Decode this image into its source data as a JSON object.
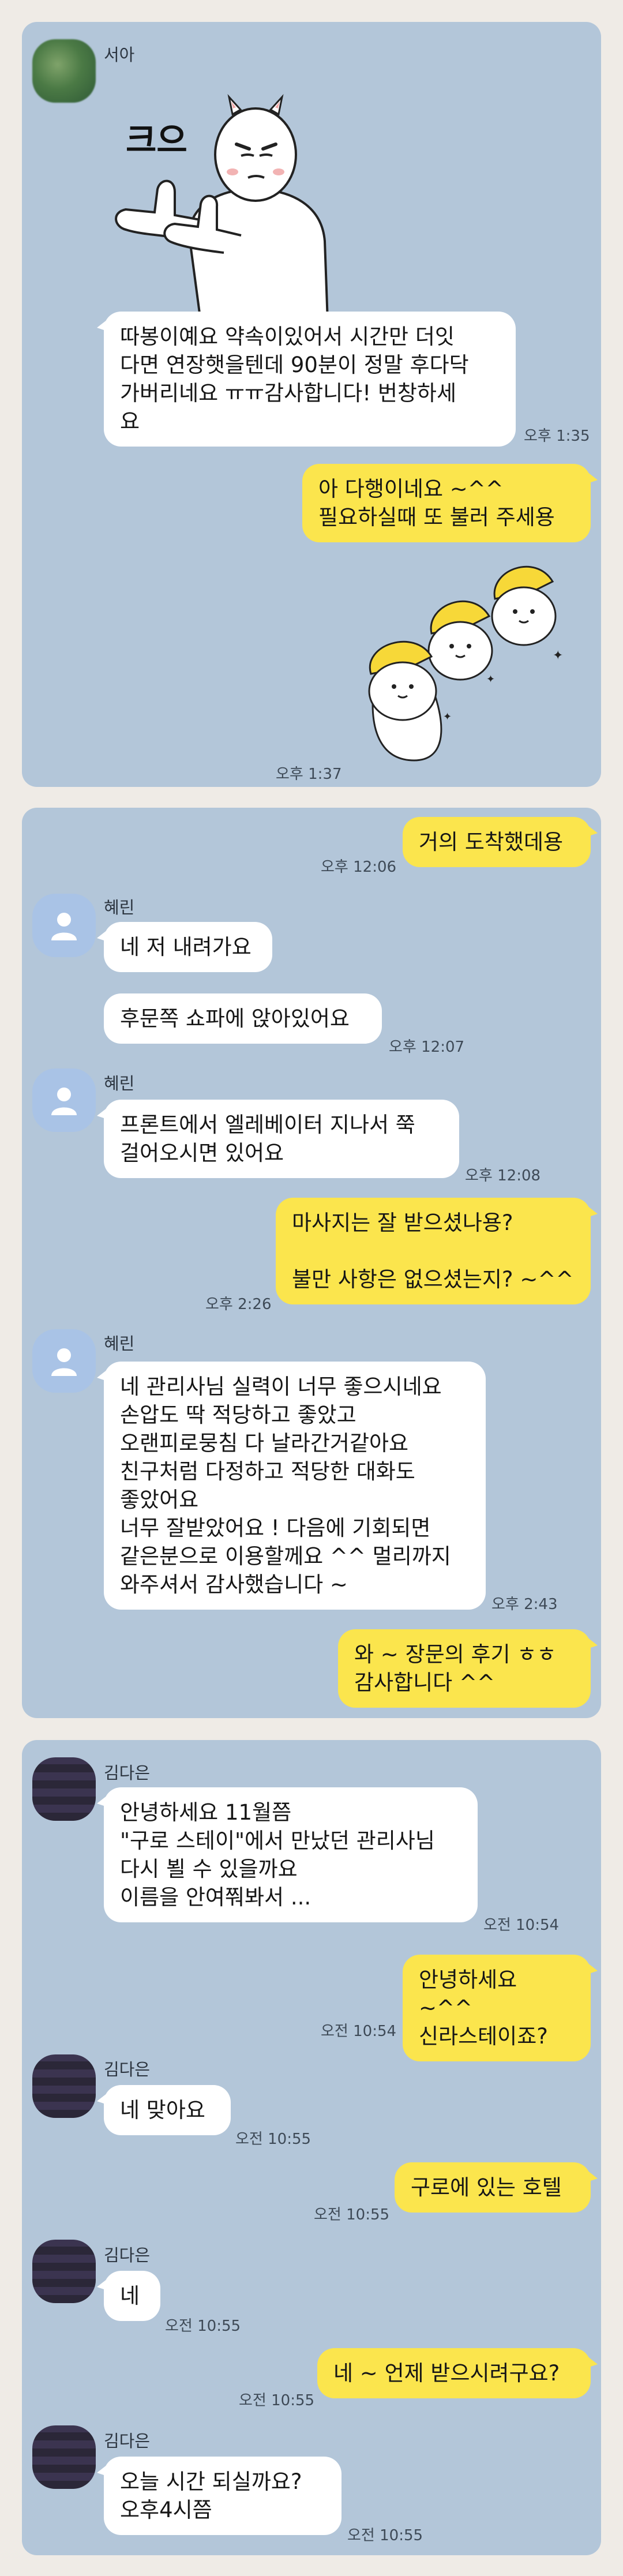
{
  "panels": [
    {
      "messages": [
        {
          "sender": "서아",
          "time": "오후 1:35",
          "sticker_text": "크으",
          "text": "따봉이예요 약속이있어서 시간만 더잇\n다면 연장햇을텐데 90분이 정말 후다닥\n가버리네요 ㅠㅠ감사합니다! 번창하세\n요"
        },
        {
          "text": "아 다행이네요 ~^^\n필요하실때 또 불러 주세용",
          "time": "오후 1:37"
        }
      ]
    },
    {
      "messages": [
        {
          "text": "거의 도착했데용",
          "time": "오후 12:06"
        },
        {
          "sender": "혜린",
          "text1": "네 저 내려가요",
          "text2": "후문쪽 쇼파에 앉아있어요",
          "time": "오후 12:07"
        },
        {
          "sender": "혜린",
          "text": "프론트에서 엘레베이터 지나서 쭉\n걸어오시면 있어요",
          "time": "오후 12:08"
        },
        {
          "text": "마사지는 잘 받으셨나용?\n\n불만 사항은 없으셨는지? ~^^",
          "time": "오후 2:26"
        },
        {
          "sender": "혜린",
          "text": "네 관리사님 실력이 너무 좋으시네요\n손압도 딱 적당하고 좋았고\n오랜피로뭉침 다 날라간거같아요\n친구처럼 다정하고 적당한 대화도\n좋았어요\n너무 잘받았어요 ! 다음에 기회되면\n같은분으로 이용할께요 ^^ 멀리까지\n와주셔서 감사했습니다 ~",
          "time": "오후 2:43"
        },
        {
          "text": "와 ~ 장문의 후기 ㅎㅎ\n감사합니다 ^^"
        }
      ]
    },
    {
      "messages": [
        {
          "sender": "김다은",
          "text": "안녕하세요 11월쯤\n\"구로 스테이\"에서 만났던 관리사님\n다시 뵐 수 있을까요\n이름을 안여쭤봐서 ...",
          "time": "오전 10:54"
        },
        {
          "text": "안녕하세요 ~^^\n신라스테이죠?",
          "time": "오전 10:54"
        },
        {
          "sender": "김다은",
          "text": "네 맞아요",
          "time": "오전 10:55"
        },
        {
          "text": "구로에 있는 호텔",
          "time": "오전 10:55"
        },
        {
          "sender": "김다은",
          "text": "네",
          "time": "오전 10:55"
        },
        {
          "text": "네 ~ 언제 받으시려구요?",
          "time": "오전 10:55"
        },
        {
          "sender": "김다은",
          "text": "오늘  시간 되실까요?\n오후4시쯤",
          "time": "오전 10:55"
        }
      ]
    }
  ]
}
